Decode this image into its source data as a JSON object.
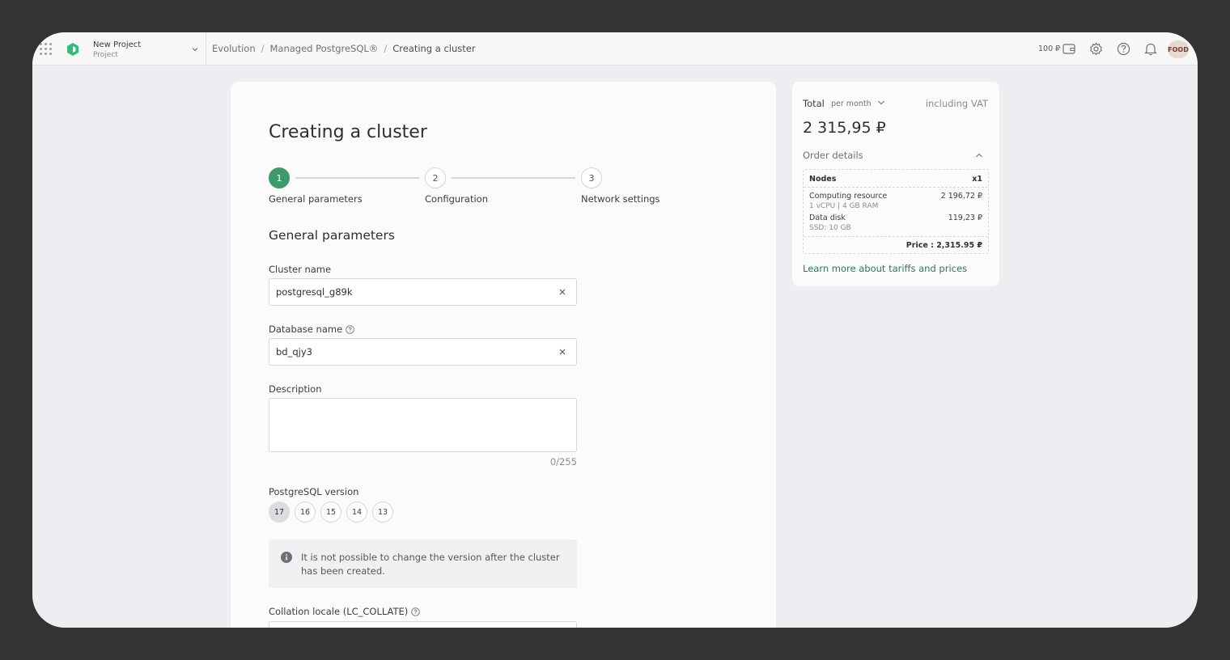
{
  "topbar": {
    "project_name": "New Project",
    "project_type": "Project",
    "breadcrumb": [
      "Evolution",
      "Managed PostgreSQL®",
      "Creating a cluster"
    ],
    "breadcrumb_sep": "/",
    "balance": "100 ₽",
    "avatar": "FOOD"
  },
  "form": {
    "title": "Creating a cluster",
    "steps": [
      {
        "number": "1",
        "label": "General parameters"
      },
      {
        "number": "2",
        "label": "Configuration"
      },
      {
        "number": "3",
        "label": "Network settings"
      }
    ],
    "active_step": 1,
    "section_title": "General parameters",
    "cluster_name_label": "Cluster name",
    "cluster_name_value": "postgresql_g89k",
    "database_name_label": "Database name",
    "database_name_value": "bd_qjy3",
    "description_label": "Description",
    "description_value": "",
    "description_counter": "0/255",
    "version_label": "PostgreSQL version",
    "versions": [
      "17",
      "16",
      "15",
      "14",
      "13"
    ],
    "selected_version": "17",
    "notice": "It is not possible to change the version after the cluster has been created.",
    "collation_label": "Collation locale (LC_COLLATE)"
  },
  "summary": {
    "total_label": "Total",
    "period": "per month",
    "vat": "including VAT",
    "price": "2 315,95 ₽",
    "order_details_label": "Order details",
    "nodes_label": "Nodes",
    "nodes_count": "x1",
    "computing_label": "Computing resource",
    "computing_spec": "1 vCPU | 4 GB RAM",
    "computing_price": "2 196,72 ₽",
    "disk_label": "Data disk",
    "disk_spec": "SSD: 10 GB",
    "disk_price": "119,23 ₽",
    "price_line": "Price : 2,315.95 ₽",
    "learn_more": "Learn more about tariffs and prices"
  },
  "colors": {
    "accent_green": "#3f9a6b",
    "link_green": "#2f7a56",
    "background": "#edeef2"
  }
}
